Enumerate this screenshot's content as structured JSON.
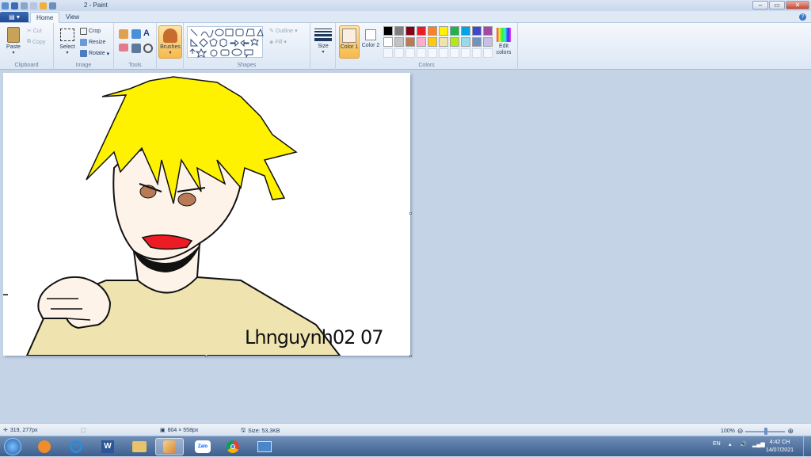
{
  "window": {
    "title": "2 - Paint",
    "minimize": "–",
    "maximize": "▭",
    "close": "✕"
  },
  "app_menu": {
    "label": "▤ ▾"
  },
  "tabs": [
    {
      "label": "Home",
      "active": true
    },
    {
      "label": "View",
      "active": false
    }
  ],
  "help": "?",
  "ribbon": {
    "clipboard": {
      "group_label": "Clipboard",
      "paste": "Paste",
      "cut": "Cut",
      "copy": "Copy"
    },
    "image": {
      "group_label": "Image",
      "select": "Select",
      "crop": "Crop",
      "resize": "Resize",
      "rotate": "Rotate"
    },
    "tools": {
      "group_label": "Tools",
      "text_tool": "A"
    },
    "brushes": {
      "label": "Brushes"
    },
    "shapes": {
      "group_label": "Shapes",
      "outline": "Outline",
      "fill": "Fill"
    },
    "size": {
      "label": "Size"
    },
    "colors": {
      "group_label": "Colors",
      "color1": "Color 1",
      "color2": "Color 2",
      "edit_colors": "Edit colors",
      "color1_value": "#fbeee0",
      "color2_value": "#ffffff",
      "palette_row1": [
        "#000000",
        "#7f7f7f",
        "#880015",
        "#ed1c24",
        "#ff7f27",
        "#fff200",
        "#22b14c",
        "#00a2e8",
        "#3f48cc",
        "#a349a4"
      ],
      "palette_row2": [
        "#ffffff",
        "#c3c3c3",
        "#b97a57",
        "#ffaec9",
        "#ffc90e",
        "#efe4b0",
        "#b5e61d",
        "#99d9ea",
        "#7092be",
        "#c8bfe7"
      ]
    }
  },
  "canvas": {
    "signature_text": "Lhnguynh02 07"
  },
  "status": {
    "cursor_pos": "319, 277px",
    "selection_size": "",
    "image_size": "804 × 558px",
    "file_size": "Size: 53,3KB",
    "zoom": "100%"
  },
  "taskbar": {
    "apps": [
      "start",
      "media-player",
      "internet-explorer",
      "word",
      "explorer",
      "paint",
      "zalo",
      "chrome",
      "screenshot"
    ],
    "zalo_label": "Zalo",
    "language": "EN",
    "time": "4:42 CH",
    "date": "14/07/2021"
  }
}
